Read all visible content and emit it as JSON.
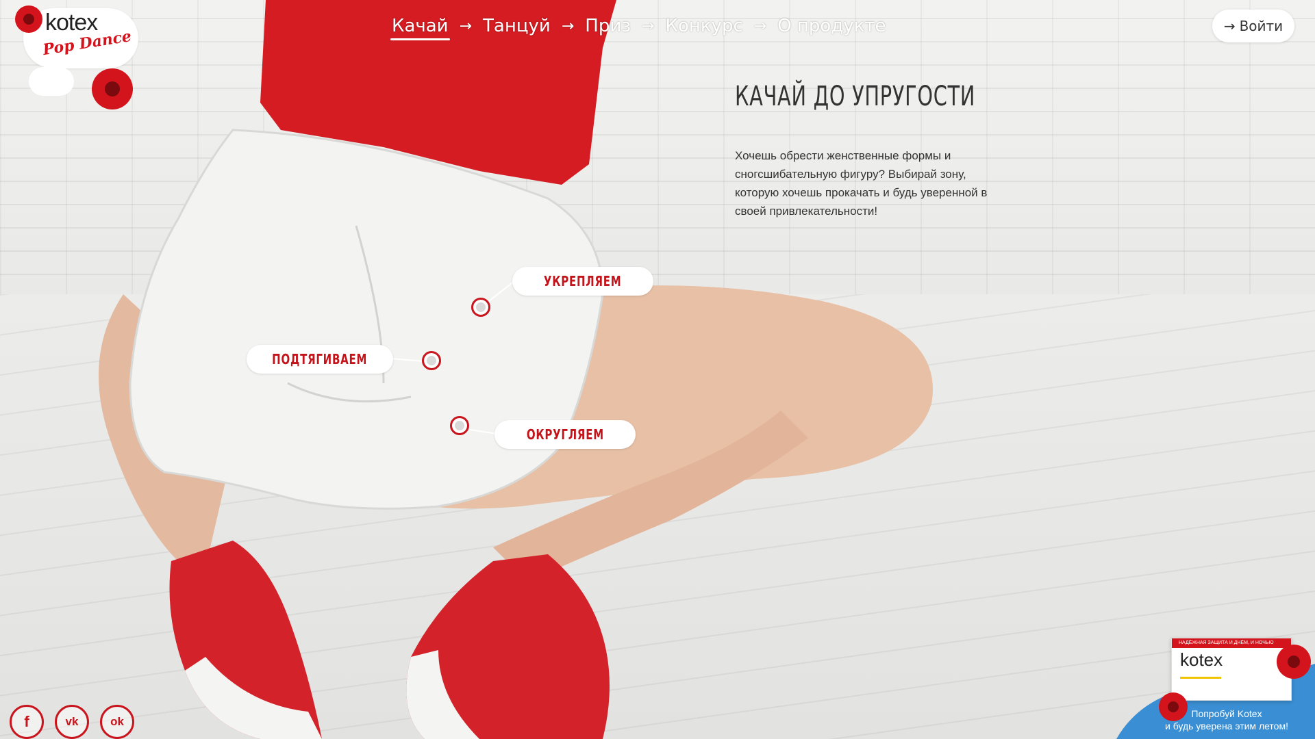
{
  "header": {
    "logo": {
      "brand": "kotex",
      "sub": "Pop Dance"
    },
    "nav": [
      {
        "label": "Качай",
        "active": true
      },
      {
        "label": "Танцуй",
        "active": false
      },
      {
        "label": "Приз",
        "active": false
      },
      {
        "label": "Конкурс",
        "active": false
      },
      {
        "label": "О продукте",
        "active": false
      }
    ],
    "nav_arrow": "→",
    "login": {
      "icon": "arrow-right-icon",
      "label": "Войти"
    }
  },
  "main": {
    "headline": "Качай до упругости",
    "description": "Хочешь обрести женственные формы и сногсшибательную фигуру? Выбирай зону, которую хочешь прокачать и будь уверенной в своей привлекательности!"
  },
  "zones": [
    {
      "label": "Укрепляем"
    },
    {
      "label": "Подтягиваем"
    },
    {
      "label": "Округляем"
    }
  ],
  "social": [
    {
      "icon": "facebook-icon",
      "glyph": "f"
    },
    {
      "icon": "vk-icon",
      "glyph": "vk"
    },
    {
      "icon": "odnoklassniki-icon",
      "glyph": "ok"
    }
  ],
  "promo": {
    "box_band": "НАДЁЖНАЯ ЗАЩИТА И ДНЁМ, И НОЧЬЮ",
    "box_brand": "kotex",
    "line1": "Попробуй Kotex",
    "line2": "и будь уверена этим летом!"
  },
  "colors": {
    "accent": "#c9151d",
    "text": "#333333",
    "background": "#e9e9e7",
    "promo_wave": "#3a8fd4"
  }
}
